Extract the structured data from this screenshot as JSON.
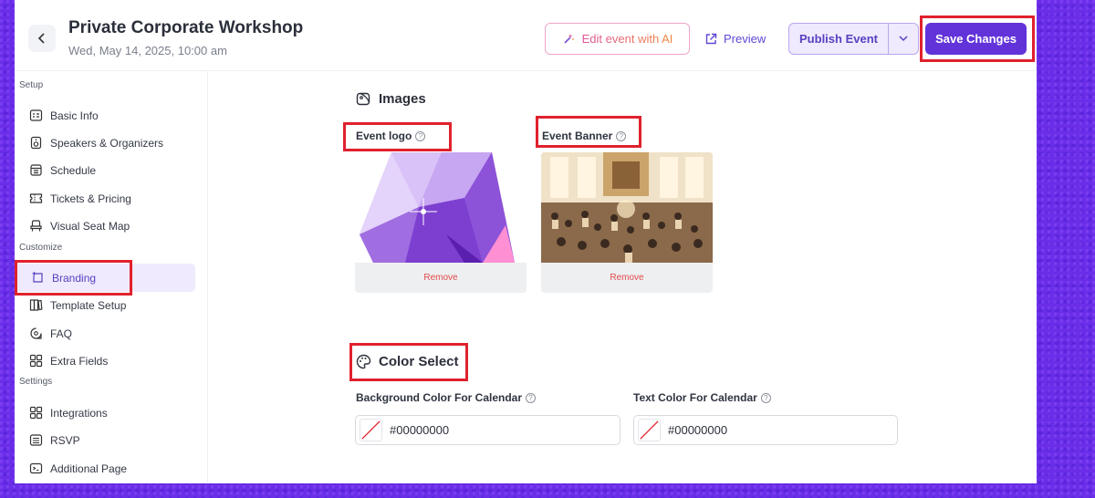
{
  "header": {
    "title": "Private Corporate Workshop",
    "subtitle": "Wed, May 14, 2025, 10:00 am",
    "ai_button": "Edit event with AI",
    "preview_button": "Preview",
    "publish_button": "Publish Event",
    "save_button": "Save Changes"
  },
  "sidebar": {
    "sections": [
      {
        "label": "Setup",
        "items": [
          {
            "label": "Basic Info",
            "icon": "id-card-icon"
          },
          {
            "label": "Speakers & Organizers",
            "icon": "speaker-icon"
          },
          {
            "label": "Schedule",
            "icon": "schedule-icon"
          },
          {
            "label": "Tickets & Pricing",
            "icon": "ticket-icon"
          },
          {
            "label": "Visual Seat Map",
            "icon": "seat-icon"
          }
        ]
      },
      {
        "label": "Customize",
        "items": [
          {
            "label": "Branding",
            "icon": "branding-icon",
            "active": true
          },
          {
            "label": "Template Setup",
            "icon": "template-icon"
          },
          {
            "label": "FAQ",
            "icon": "faq-icon"
          },
          {
            "label": "Extra Fields",
            "icon": "grid-icon"
          }
        ]
      },
      {
        "label": "Settings",
        "items": [
          {
            "label": "Integrations",
            "icon": "integrations-icon"
          },
          {
            "label": "RSVP",
            "icon": "rsvp-icon"
          },
          {
            "label": "Additional Page",
            "icon": "page-icon"
          }
        ]
      }
    ]
  },
  "images": {
    "heading": "Images",
    "logo_label": "Event logo",
    "banner_label": "Event Banner",
    "remove_label": "Remove"
  },
  "colors": {
    "heading": "Color Select",
    "bg_label": "Background Color For Calendar",
    "text_label": "Text Color For Calendar",
    "bg_value": "#00000000",
    "text_value": "#00000000"
  },
  "theme": {
    "accent": "#6233d9",
    "highlight": "#e0212d",
    "remove": "#e34a4a"
  }
}
